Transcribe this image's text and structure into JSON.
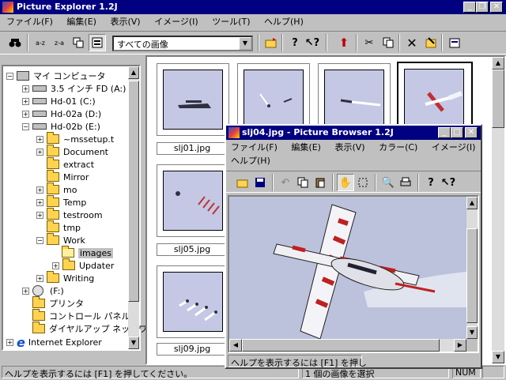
{
  "main_window": {
    "title": "Picture Explorer 1.2J",
    "menu": [
      "ファイル(F)",
      "編集(E)",
      "表示(V)",
      "イメージ(I)",
      "ツール(T)",
      "ヘルプ(H)"
    ],
    "filter_value": "すべての画像",
    "status": "ヘルプを表示するには [F1] を押してください。",
    "status_right": "1 個の画像を選択",
    "status_num": "NUM"
  },
  "tree": [
    {
      "label": "マイ コンピュータ"
    },
    {
      "label": "3.5 インチ FD (A:)"
    },
    {
      "label": "Hd-01 (C:)"
    },
    {
      "label": "Hd-02a (D:)"
    },
    {
      "label": "Hd-02b (E:)"
    },
    {
      "label": "~mssetup.t"
    },
    {
      "label": "Document"
    },
    {
      "label": "extract"
    },
    {
      "label": "Mirror"
    },
    {
      "label": "mo"
    },
    {
      "label": "Temp"
    },
    {
      "label": "testroom"
    },
    {
      "label": "tmp"
    },
    {
      "label": "Work"
    },
    {
      "label": "images"
    },
    {
      "label": "Updater"
    },
    {
      "label": "Writing"
    },
    {
      "label": "(F:)"
    },
    {
      "label": "プリンタ"
    },
    {
      "label": "コントロール パネル"
    },
    {
      "label": "ダイヤルアップ ネットワーク"
    },
    {
      "label": "Internet Explorer"
    }
  ],
  "thumbnails": [
    {
      "caption": "slj01.jpg"
    },
    {
      "caption": "slj05.jpg"
    },
    {
      "caption": "slj09.jpg"
    }
  ],
  "browser_window": {
    "title": "slj04.jpg - Picture Browser 1.2J",
    "menu_row1": [
      "ファイル(F)",
      "編集(E)",
      "表示(V)",
      "カラー(C)",
      "イメージ(I)"
    ],
    "menu_row2": [
      "ヘルプ(H)"
    ],
    "status": "ヘルプを表示するには [F1] を押し"
  }
}
